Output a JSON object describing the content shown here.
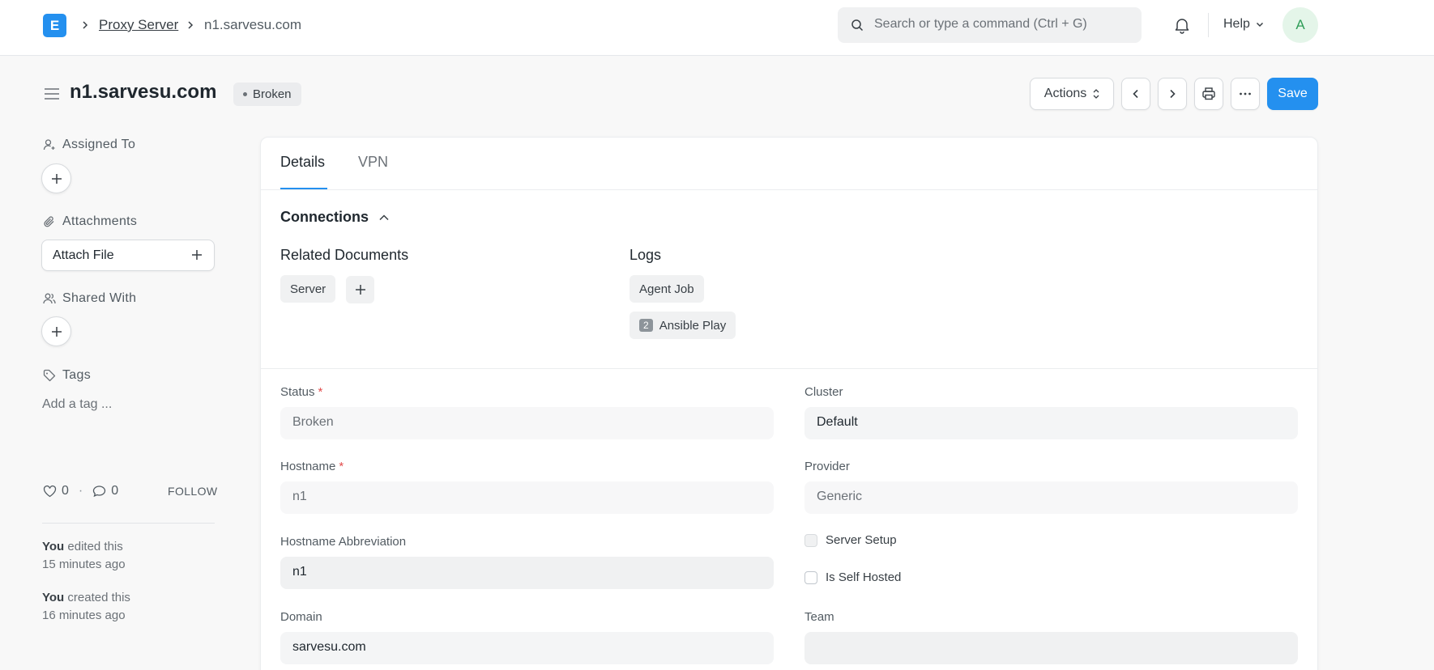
{
  "navbar": {
    "logo_letter": "E",
    "breadcrumbs": [
      "Proxy Server",
      "n1.sarvesu.com"
    ],
    "search_placeholder": "Search or type a command (Ctrl + G)",
    "help_label": "Help",
    "avatar_letter": "A"
  },
  "page": {
    "title": "n1.sarvesu.com",
    "status_indicator": "Broken",
    "actions_label": "Actions",
    "save_label": "Save"
  },
  "sidebar": {
    "assigned_to_label": "Assigned To",
    "attachments_label": "Attachments",
    "attach_file_label": "Attach File",
    "shared_with_label": "Shared With",
    "tags_label": "Tags",
    "add_tag_placeholder": "Add a tag ...",
    "likes_count": "0",
    "comments_count": "0",
    "follow_label": "FOLLOW",
    "activity": [
      {
        "user": "You",
        "action": "edited this",
        "time": "15 minutes ago"
      },
      {
        "user": "You",
        "action": "created this",
        "time": "16 minutes ago"
      }
    ]
  },
  "tabs": [
    "Details",
    "VPN"
  ],
  "connections": {
    "title": "Connections",
    "related_documents_title": "Related Documents",
    "related_documents": [
      "Server"
    ],
    "logs_title": "Logs",
    "logs": [
      {
        "label": "Agent Job",
        "count": ""
      },
      {
        "label": "Ansible Play",
        "count": "2"
      }
    ]
  },
  "form": {
    "status": {
      "label": "Status",
      "value": "Broken"
    },
    "hostname": {
      "label": "Hostname",
      "value": "n1"
    },
    "hostname_abbreviation": {
      "label": "Hostname Abbreviation",
      "value": "n1"
    },
    "domain": {
      "label": "Domain",
      "value": "sarvesu.com"
    },
    "cluster": {
      "label": "Cluster",
      "value": "Default"
    },
    "provider": {
      "label": "Provider",
      "value": "Generic"
    },
    "server_setup": {
      "label": "Server Setup",
      "checked": false
    },
    "is_self_hosted": {
      "label": "Is Self Hosted",
      "checked": false
    },
    "team": {
      "label": "Team",
      "value": ""
    }
  },
  "colors": {
    "primary": "#2490ef",
    "required": "#e24c4c"
  }
}
